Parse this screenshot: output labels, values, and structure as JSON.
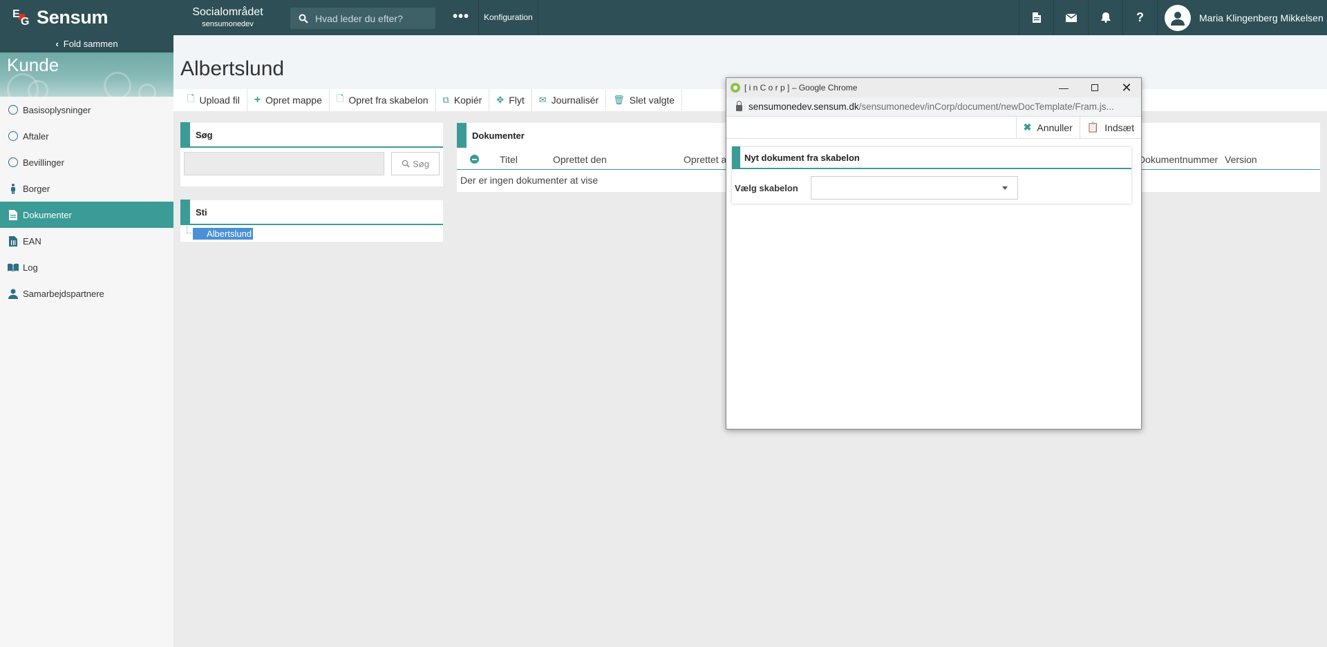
{
  "header": {
    "brand": "Sensum",
    "area_title": "Socialområdet",
    "area_subtitle": "sensumonedev",
    "search_placeholder": "Hvad leder du efter?",
    "config_label": "Konfiguration",
    "user_name": "Maria Klingenberg Mikkelsen"
  },
  "sidebar": {
    "fold_label": "Fold sammen",
    "section_title": "Kunde",
    "items": [
      {
        "label": "Basisoplysninger",
        "icon": "circle-icon"
      },
      {
        "label": "Aftaler",
        "icon": "circle-icon"
      },
      {
        "label": "Bevillinger",
        "icon": "circle-icon"
      },
      {
        "label": "Borger",
        "icon": "person-icon"
      },
      {
        "label": "Dokumenter",
        "icon": "document-icon",
        "active": true
      },
      {
        "label": "EAN",
        "icon": "ean-document-icon"
      },
      {
        "label": "Log",
        "icon": "book-icon"
      },
      {
        "label": "Samarbejdspartnere",
        "icon": "partner-icon"
      }
    ]
  },
  "page": {
    "title": "Albertslund"
  },
  "toolbar": {
    "upload": "Upload fil",
    "new_folder": "Opret mappe",
    "from_template": "Opret fra skabelon",
    "copy": "Kopiér",
    "move": "Flyt",
    "journalize": "Journalisér",
    "delete_selected": "Slet valgte"
  },
  "search_panel": {
    "title": "Søg",
    "button": "Søg"
  },
  "path_panel": {
    "title": "Sti",
    "node": "Albertslund"
  },
  "documents_panel": {
    "title": "Dokumenter",
    "columns": [
      "Titel",
      "Oprettet den",
      "Oprettet a",
      "Dokumentnummer",
      "Version"
    ],
    "empty_text": "Der er ingen dokumenter at vise"
  },
  "popup": {
    "window_title": "[ i n C o r p ] – Google Chrome",
    "url_host": "sensumonedev.sensum.dk",
    "url_path": "/sensumonedev/inCorp/document/newDocTemplate/Fram.js...",
    "cancel": "Annuller",
    "insert": "Indsæt",
    "panel_title": "Nyt dokument fra skabelon",
    "select_label": "Vælg skabelon",
    "select_value": ""
  },
  "colors": {
    "header_bg": "#2d4f55",
    "accent": "#3a9b97",
    "tree_selection": "#4a90d6"
  }
}
